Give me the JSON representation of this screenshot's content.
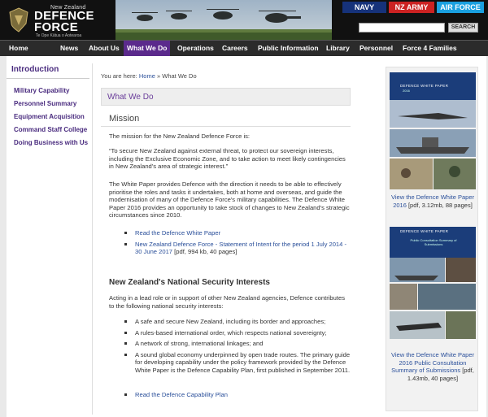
{
  "header": {
    "logo_top": "New Zealand",
    "logo_main_1": "DEFENCE",
    "logo_main_2": "FORCE",
    "logo_tag": "Te Ope Kātua o Aotearoa",
    "services": [
      "NAVY",
      "NZ ARMY",
      "AIR FORCE"
    ],
    "search_placeholder": "",
    "search_button": "SEARCH"
  },
  "nav": [
    "Home",
    "News",
    "About Us",
    "What We Do",
    "Operations",
    "Careers",
    "Public Information",
    "Library",
    "Personnel",
    "Force 4 Families"
  ],
  "sidebar": {
    "title": "Introduction",
    "items": [
      "Military Capability",
      "Personnel Summary",
      "Equipment Acquisition",
      "Command Staff College",
      "Doing Business with Us"
    ]
  },
  "breadcrumb": {
    "prefix": "You are here:",
    "home": "Home",
    "sep": "»",
    "current": "What We Do"
  },
  "main": {
    "section_title": "What We Do",
    "mission_title": "Mission",
    "intro": "The mission for the New Zealand Defence Force is:",
    "quote": "“To secure New Zealand against external threat, to protect our sovereign interests, including the Exclusive Economic Zone, and to take action to meet likely contingencies in New Zealand's area of strategic interest.”",
    "white_paper": "The White Paper provides Defence with the direction it needs to be able to effectively prioritise the roles and tasks it undertakes, both at home and overseas, and guide the modernisation of many of the Defence Force's military capabilities. The Defence White Paper 2016 provides an opportunity to take stock of changes to New Zealand's strategic circumstances since 2010.",
    "links": [
      {
        "text": "Read the Defence White Paper",
        "extra": ""
      },
      {
        "text": "New Zealand Defence Force - Statement of Intent for the period 1 July 2014 - 30 June 2017",
        "extra": " [pdf, 994 kb, 40 pages]"
      }
    ],
    "security_title": "New Zealand's National Security Interests",
    "security_intro": "Acting in a lead role or in support of other New Zealand agencies, Defence contributes to the following national security interests:",
    "bullets": [
      "A safe and secure New Zealand, including its border and approaches;",
      "A rules-based international order, which respects national sovereignty;",
      "A network of strong, international linkages; and",
      "A sound global economy underpinned by open trade routes. The primary guide for developing capability under the policy framework provided by the Defence White Paper is the Defence Capability Plan, first published in September 2011."
    ],
    "final_link": "Read the Defence Capability Plan"
  },
  "right": {
    "doc1_title": "DEFENCE WHITE PAPER",
    "doc1_year": "2016",
    "doc1_link": "View the Defence White Paper 2016",
    "doc1_meta": " [pdf, 3.12mb, 88 pages]",
    "doc2_title": "DEFENCE WHITE PAPER",
    "doc2_sub": "Public Consultation Summary of Submissions",
    "doc2_link": "View the Defence White Paper 2016 Public Consultation Summary of Submissions",
    "doc2_meta": " [pdf, 1.43mb, 40 pages]"
  }
}
